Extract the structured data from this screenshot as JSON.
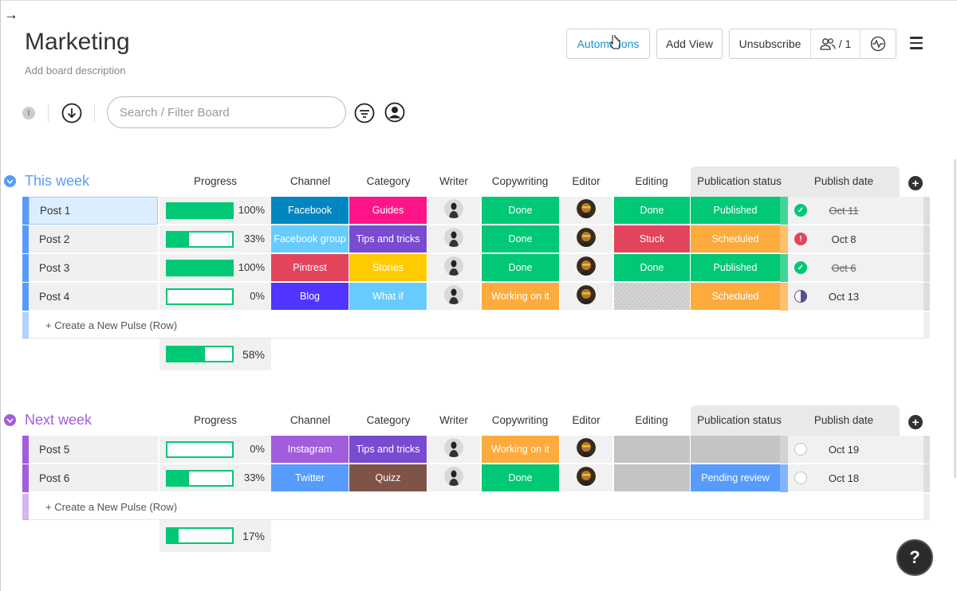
{
  "nav": {
    "back_arrow": "→"
  },
  "board": {
    "title": "Marketing",
    "description": "Add board description"
  },
  "header_buttons": {
    "automations": "Automations",
    "add_view": "Add View",
    "unsubscribe": "Unsubscribe",
    "members_count": "/ 1"
  },
  "toolbar": {
    "search_placeholder": "Search / Filter Board",
    "info_badge": "I"
  },
  "columns": [
    "Progress",
    "Channel",
    "Category",
    "Writer",
    "Copywriting",
    "Editor",
    "Editing",
    "Publication status",
    "Publish date"
  ],
  "groups": [
    {
      "title": "This week",
      "color": "#579bfc",
      "create_label": "+ Create a New Pulse (Row)",
      "summary_progress": "58%",
      "summary_fraction": 0.58,
      "rows": [
        {
          "name": "Post 1",
          "progress": "100%",
          "progress_fraction": 1.0,
          "channel": "Facebook",
          "category": "Guides",
          "copywriting": "Done",
          "editing": "Done",
          "publication": "Published",
          "date": "Oct 11",
          "date_state": "done"
        },
        {
          "name": "Post 2",
          "progress": "33%",
          "progress_fraction": 0.33,
          "channel": "Facebook group",
          "category": "Tips and tricks",
          "copywriting": "Done",
          "editing": "Stuck",
          "publication": "Scheduled",
          "date": "Oct 8",
          "date_state": "overdue"
        },
        {
          "name": "Post 3",
          "progress": "100%",
          "progress_fraction": 1.0,
          "channel": "Pintrest",
          "category": "Stories",
          "copywriting": "Done",
          "editing": "Done",
          "publication": "Published",
          "date": "Oct 6",
          "date_state": "done"
        },
        {
          "name": "Post 4",
          "progress": "0%",
          "progress_fraction": 0,
          "channel": "Blog",
          "category": "What if",
          "copywriting": "Working on it",
          "editing": "",
          "publication": "Scheduled",
          "date": "Oct 13",
          "date_state": "half"
        }
      ]
    },
    {
      "title": "Next week",
      "color": "#a25ddc",
      "create_label": "+ Create a New Pulse (Row)",
      "summary_progress": "17%",
      "summary_fraction": 0.17,
      "rows": [
        {
          "name": "Post 5",
          "progress": "0%",
          "progress_fraction": 0,
          "channel": "Instagram",
          "category": "Tips and tricks",
          "copywriting": "Working on it",
          "editing": "",
          "publication": "",
          "date": "Oct 19",
          "date_state": "empty"
        },
        {
          "name": "Post 6",
          "progress": "33%",
          "progress_fraction": 0.33,
          "channel": "Twitter",
          "category": "Quizz",
          "copywriting": "Done",
          "editing": "",
          "publication": "Pending review",
          "date": "Oct 18",
          "date_state": "empty"
        }
      ]
    }
  ],
  "colors": {
    "done": "#00c875",
    "stuck": "#e2445c",
    "working": "#fdab3d",
    "scheduled": "#fdab3d",
    "published": "#00c875",
    "pending": "#579bfc",
    "empty": "#c4c4c4",
    "facebook": "#0086c0",
    "facebook_group": "#66ccff",
    "pintrest": "#e2445c",
    "blog": "#5034ff",
    "instagram": "#a25ddc",
    "twitter": "#579bfc",
    "guides": "#ff158a",
    "tips": "#784bd1",
    "stories": "#ffcb00",
    "whatif": "#66ccff",
    "quizz": "#7f5347"
  },
  "help_button": "?"
}
